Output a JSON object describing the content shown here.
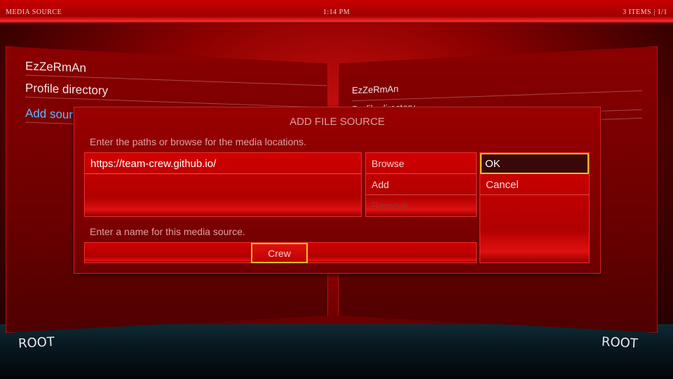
{
  "header": {
    "window_title": "MEDIA SOURCE",
    "clock": "1:14 PM",
    "item_count": "3 ITEMS | 1/1"
  },
  "left_list": {
    "items": [
      {
        "label": "EzZeRmAn"
      },
      {
        "label": "Profile directory"
      },
      {
        "label": "Add sour"
      }
    ],
    "footer": "ROOT"
  },
  "right_list": {
    "items": [
      {
        "label": "EzZeRmAn"
      },
      {
        "label": "Profile directory"
      }
    ],
    "footer": "ROOT"
  },
  "dialog": {
    "title": "ADD FILE SOURCE",
    "paths_hint": "Enter the paths or browse for the media locations.",
    "path_value": "https://team-crew.github.io/",
    "buttons": {
      "browse": "Browse",
      "add": "Add",
      "remove": "Remove",
      "ok": "OK",
      "cancel": "Cancel"
    },
    "name_hint": "Enter a name for this media source.",
    "name_value": "Crew"
  },
  "colors": {
    "accent_focus": "#e8c020",
    "highlight_text": "#5ab8ff"
  }
}
